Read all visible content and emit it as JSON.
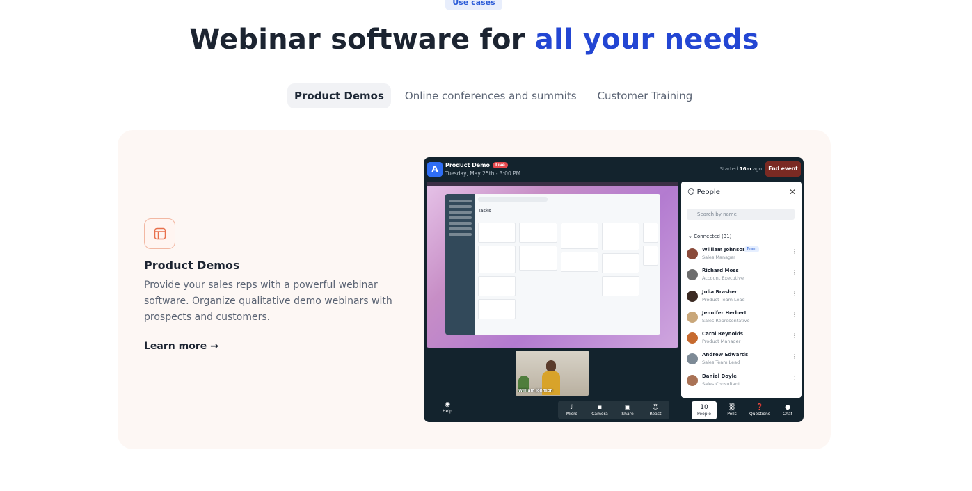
{
  "eyebrow": "Use cases",
  "headline": {
    "main": "Webinar software for ",
    "accent": "all your needs"
  },
  "tabs": [
    {
      "label": "Product Demos",
      "active": true
    },
    {
      "label": "Online conferences and summits",
      "active": false
    },
    {
      "label": "Customer Training",
      "active": false
    }
  ],
  "feature": {
    "title": "Product Demos",
    "description": "Provide your sales reps with a powerful webinar software. Organize qualitative demo webinars with prospects and customers.",
    "cta": "Learn more →"
  },
  "app": {
    "logo_letter": "A",
    "title": "Product Demo",
    "live_badge": "Live",
    "date": "Tuesday, May 25th - 3:00 PM",
    "started_prefix": "Started ",
    "started_value": "16m",
    "started_suffix": " ago",
    "end_event": "End event",
    "screen_title": "Tasks",
    "speaker_name": "William Johnson",
    "people_panel": {
      "title": "People",
      "search_placeholder": "Search by name",
      "connected_label": "Connected (31)",
      "people": [
        {
          "name": "William Johnson",
          "role": "Sales Manager",
          "badge": "Team",
          "color": "#8a4a3a"
        },
        {
          "name": "Richard Moss",
          "role": "Account Executive",
          "color": "#6d6d6d"
        },
        {
          "name": "Julia Brasher",
          "role": "Product Team Lead",
          "color": "#3b2a22"
        },
        {
          "name": "Jennifer Herbert",
          "role": "Sales Representative",
          "color": "#c9a77a"
        },
        {
          "name": "Carol Reynolds",
          "role": "Product Manager",
          "color": "#c66a2f"
        },
        {
          "name": "Andrew Edwards",
          "role": "Sales Team Lead",
          "color": "#7d8a96"
        },
        {
          "name": "Daniel Doyle",
          "role": "Sales Consultant",
          "color": "#a97255"
        }
      ]
    },
    "toolbar": {
      "help": "Help",
      "center": [
        "Micro",
        "Camera",
        "Share",
        "React"
      ],
      "right": [
        {
          "label": "People",
          "count": "10",
          "active": true
        },
        {
          "label": "Polls",
          "active": false
        },
        {
          "label": "Questions",
          "active": false
        },
        {
          "label": "Chat",
          "active": false
        }
      ]
    }
  }
}
